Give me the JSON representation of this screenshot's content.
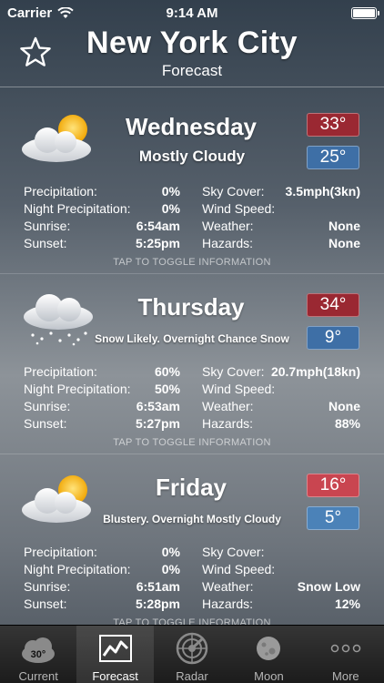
{
  "status": {
    "carrier": "Carrier",
    "time": "9:14 AM"
  },
  "header": {
    "city": "New York City",
    "subtitle": "Forecast"
  },
  "days": [
    {
      "name": "Wednesday",
      "condition": "Mostly Cloudy",
      "high": "33°",
      "low": "25°",
      "rows": [
        {
          "l1": "Precipitation:",
          "v1": "0%",
          "l2": "Sky Cover:",
          "v2": "3.5mph(3kn)"
        },
        {
          "l1": "Night Precipitation:",
          "v1": "0%",
          "l2": "Wind Speed:",
          "v2": ""
        },
        {
          "l1": "Sunrise:",
          "v1": "6:54am",
          "l2": "Weather:",
          "v2": "None"
        },
        {
          "l1": "Sunset:",
          "v1": "5:25pm",
          "l2": "Hazards:",
          "v2": "None"
        }
      ],
      "toggle": "TAP TO TOGGLE INFORMATION"
    },
    {
      "name": "Thursday",
      "condition": "Snow Likely. Overnight Chance Snow",
      "high": "34°",
      "low": "9°",
      "rows": [
        {
          "l1": "Precipitation:",
          "v1": "60%",
          "l2": "Sky Cover:",
          "v2": "20.7mph(18kn)"
        },
        {
          "l1": "Night Precipitation:",
          "v1": "50%",
          "l2": "Wind Speed:",
          "v2": ""
        },
        {
          "l1": "Sunrise:",
          "v1": "6:53am",
          "l2": "Weather:",
          "v2": "None"
        },
        {
          "l1": "Sunset:",
          "v1": "5:27pm",
          "l2": "Hazards:",
          "v2": "88%"
        }
      ],
      "toggle": "TAP TO TOGGLE INFORMATION"
    },
    {
      "name": "Friday",
      "condition": "Blustery. Overnight Mostly Cloudy",
      "high": "16°",
      "low": "5°",
      "rows": [
        {
          "l1": "Precipitation:",
          "v1": "0%",
          "l2": "Sky Cover:",
          "v2": ""
        },
        {
          "l1": "Night Precipitation:",
          "v1": "0%",
          "l2": "Wind Speed:",
          "v2": ""
        },
        {
          "l1": "Sunrise:",
          "v1": "6:51am",
          "l2": "Weather:",
          "v2": "Snow Low"
        },
        {
          "l1": "Sunset:",
          "v1": "5:28pm",
          "l2": "Hazards:",
          "v2": "12%"
        }
      ],
      "toggle": "TAP TO TOGGLE INFORMATION"
    }
  ],
  "tabs": [
    {
      "label": "Current",
      "icon": "current-weather-icon",
      "badge": "30°"
    },
    {
      "label": "Forecast",
      "icon": "forecast-chart-icon"
    },
    {
      "label": "Radar",
      "icon": "radar-icon"
    },
    {
      "label": "Moon",
      "icon": "moon-icon"
    },
    {
      "label": "More",
      "icon": "more-dots-icon"
    }
  ],
  "colors": {
    "high": "#9a2832",
    "low": "#3e6fa6",
    "tab_bg": "#1c1c1c"
  }
}
